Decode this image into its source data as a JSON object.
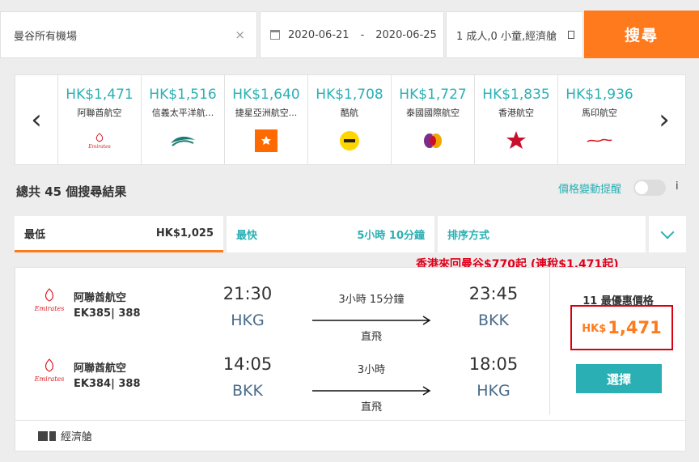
{
  "search": {
    "destination": "曼谷所有機場",
    "clear_glyph": "×",
    "date_from": "2020-06-21",
    "date_sep": "-",
    "date_to": "2020-06-25",
    "passengers": "1 成人,0 小童,經濟艙",
    "search_label": "搜尋"
  },
  "carousel": {
    "prev_glyph": "‹",
    "next_glyph": "›",
    "airlines": [
      {
        "price": "HK$1,471",
        "name": "阿聯酋航空",
        "logo": "emirates-logo"
      },
      {
        "price": "HK$1,516",
        "name": "信義太平洋航...",
        "logo": "cathay-logo"
      },
      {
        "price": "HK$1,640",
        "name": "捷星亞洲航空...",
        "logo": "jetstar-logo"
      },
      {
        "price": "HK$1,708",
        "name": "酷航",
        "logo": "scoot-logo"
      },
      {
        "price": "HK$1,727",
        "name": "泰國國際航空",
        "logo": "thai-logo"
      },
      {
        "price": "HK$1,835",
        "name": "香港航空",
        "logo": "hongkong-airlines-logo"
      },
      {
        "price": "HK$1,936",
        "name": "馬印航空",
        "logo": "malindo-logo"
      }
    ]
  },
  "results": {
    "count_text": "總共 45 個搜尋結果",
    "price_alert_label": "價格變動提醒",
    "price_alert_on": false,
    "trailing_char": "i"
  },
  "sort": {
    "cheapest_label": "最低",
    "cheapest_value": "HK$1,025",
    "fastest_label": "最快",
    "fastest_value": "5小時 10分鐘",
    "sort_label": "排序方式"
  },
  "promo": "香港來回曼谷$770起 (連稅$1,471起)",
  "result": {
    "legs": [
      {
        "airline": "阿聯酋航空",
        "flight_no": "EK385| 388",
        "dep_time": "21:30",
        "dep_code": "HKG",
        "duration": "3小時 15分鐘",
        "stops": "直飛",
        "arr_time": "23:45",
        "arr_code": "BKK"
      },
      {
        "airline": "阿聯酋航空",
        "flight_no": "EK384| 388",
        "dep_time": "14:05",
        "dep_code": "BKK",
        "duration": "3小時",
        "stops": "直飛",
        "arr_time": "18:05",
        "arr_code": "HKG"
      }
    ],
    "deal_count": "11 最優惠價格",
    "currency": "HK$",
    "price": "1,471",
    "select_label": "選擇",
    "cabin": "經濟艙",
    "logo_word": "Emirates"
  },
  "colors": {
    "accent_orange": "#ff7a1c",
    "teal": "#2ab0b4",
    "promo_red": "#e0001b",
    "highlight_box": "#d9000d"
  }
}
